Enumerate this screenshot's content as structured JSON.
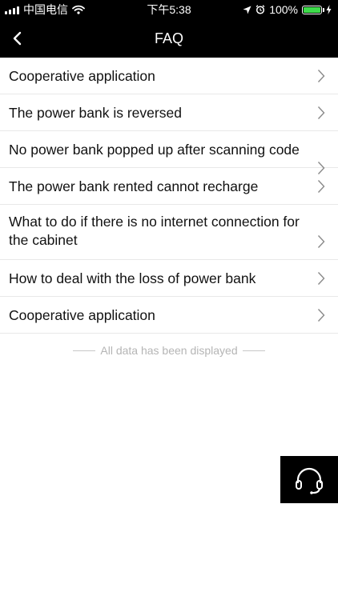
{
  "status_bar": {
    "carrier": "中国电信",
    "time": "下午5:38",
    "battery": "100%"
  },
  "nav": {
    "title": "FAQ"
  },
  "faq_items": [
    {
      "label": "Cooperative application"
    },
    {
      "label": "The power bank is reversed"
    },
    {
      "label": "No power bank popped up after scanning code"
    },
    {
      "label": "The power bank rented cannot recharge"
    },
    {
      "label": "What to do if there is no internet connection for the cabinet"
    },
    {
      "label": "How to deal with the loss of power bank"
    },
    {
      "label": "Cooperative application"
    }
  ],
  "footer": {
    "text": "All data has been displayed"
  },
  "icons": {
    "back": "chevron-left-icon",
    "item_arrow": "chevron-right-icon",
    "support": "headset-icon",
    "wifi": "wifi-icon",
    "location": "location-arrow-icon",
    "alarm": "alarm-clock-icon",
    "charging": "charging-bolt-icon"
  },
  "colors": {
    "header_bg": "#000000",
    "battery_fill": "#3ddc4a",
    "footer_text": "#b5b5b5"
  }
}
